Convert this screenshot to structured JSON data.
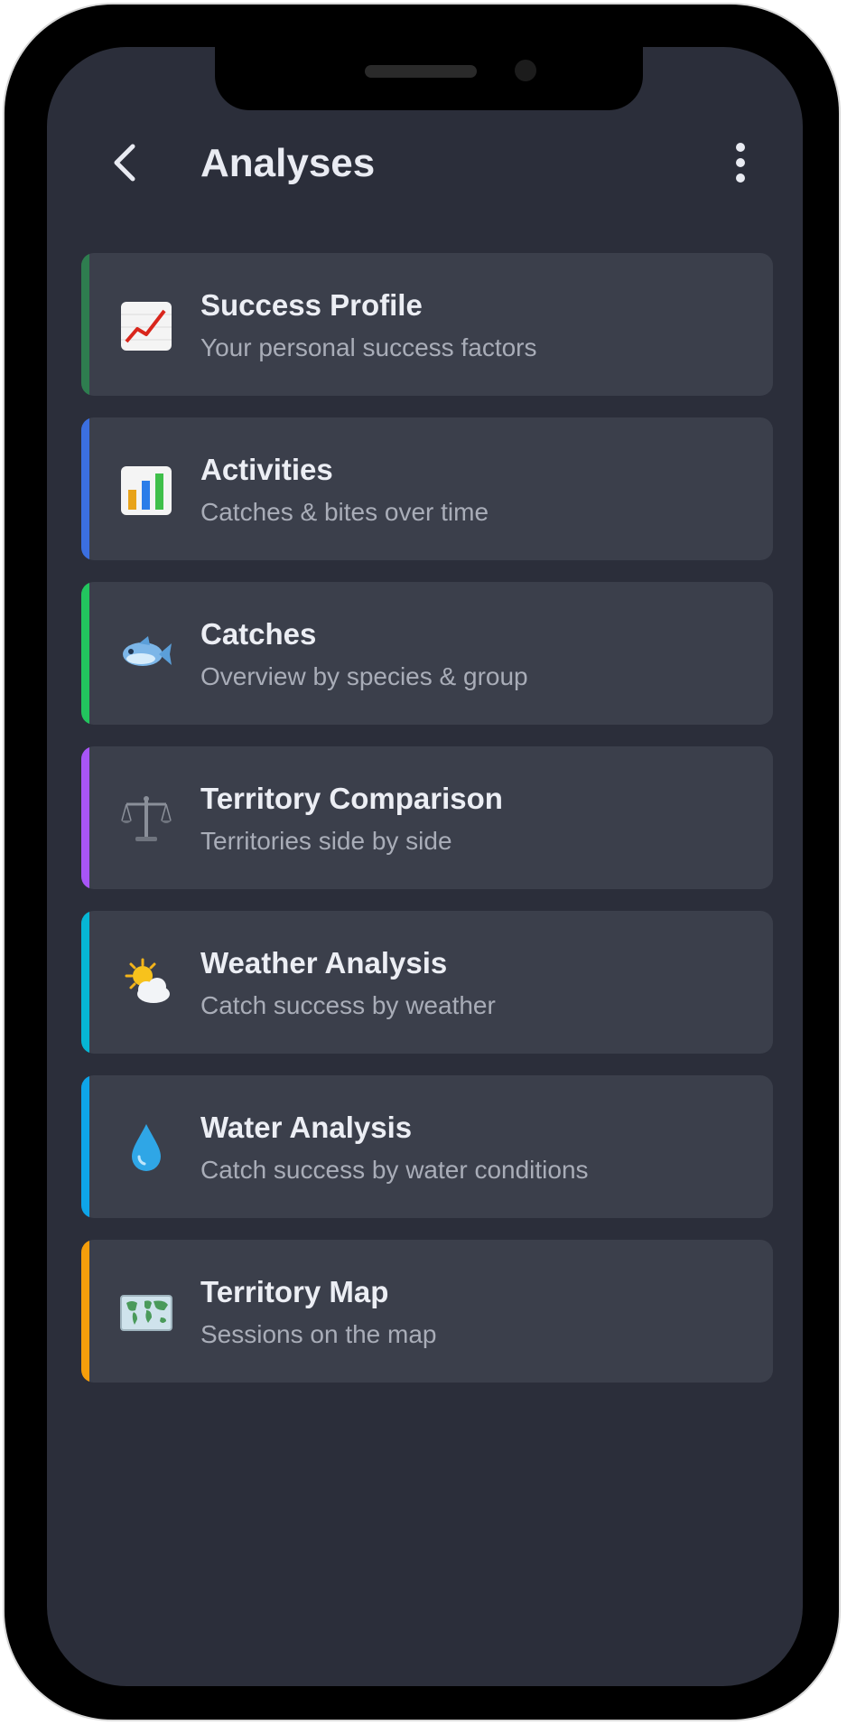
{
  "header": {
    "title": "Analyses",
    "back_icon": "chevron-left-icon",
    "menu_icon": "more-vertical-icon"
  },
  "items": [
    {
      "title": "Success Profile",
      "subtitle": "Your personal success factors",
      "icon": "trend-chart-icon",
      "accent": "#2e7d4f"
    },
    {
      "title": "Activities",
      "subtitle": "Catches & bites over time",
      "icon": "bar-chart-icon",
      "accent": "#3b6fe0"
    },
    {
      "title": "Catches",
      "subtitle": "Overview by species & group",
      "icon": "fish-icon",
      "accent": "#22c55e"
    },
    {
      "title": "Territory Comparison",
      "subtitle": "Territories side by side",
      "icon": "scales-icon",
      "accent": "#a855f7"
    },
    {
      "title": "Weather Analysis",
      "subtitle": "Catch success by weather",
      "icon": "sun-cloud-icon",
      "accent": "#06b6d4"
    },
    {
      "title": "Water Analysis",
      "subtitle": "Catch success by water conditions",
      "icon": "droplet-icon",
      "accent": "#0ea5e9"
    },
    {
      "title": "Territory Map",
      "subtitle": "Sessions on the map",
      "icon": "world-map-icon",
      "accent": "#f59e0b"
    }
  ],
  "colors": {
    "background": "#2b2e3a",
    "card": "#3b3f4b",
    "text_primary": "#eceef4",
    "text_secondary": "#a9adb8"
  }
}
